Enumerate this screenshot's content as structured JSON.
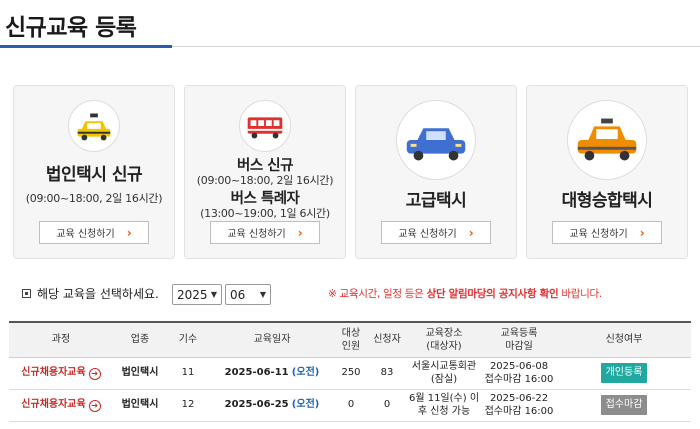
{
  "page": {
    "title": "신규교육 등록"
  },
  "cards": [
    {
      "name": "법인택시 신규",
      "time": "(09:00~18:00, 2일 16시간)",
      "button": "교육 신청하기",
      "icon": "taxi-icon",
      "icon_color": "#f5c400"
    },
    {
      "name": "버스 신규",
      "time": "(09:00~18:00, 2일 16시간)",
      "name2": "버스 특례자",
      "time2": "(13:00~19:00, 1일 6시간)",
      "button": "교육 신청하기",
      "icon": "bus-icon",
      "icon_color": "#e03131"
    },
    {
      "name": "고급택시",
      "button": "교육 신청하기",
      "icon": "premium-taxi-icon",
      "icon_color": "#3f6fd1"
    },
    {
      "name": "대형승합택시",
      "button": "교육 신청하기",
      "icon": "van-taxi-icon",
      "icon_color": "#f08c00"
    }
  ],
  "filter": {
    "label": "해당 교육을 선택하세요.",
    "year": "2025",
    "month": "06",
    "notice_prefix": "※ 교육시간, 일정 등은 ",
    "notice_strong": "상단 알림마당의 공지사항 확인",
    "notice_suffix": " 바랍니다."
  },
  "table": {
    "headers": {
      "course": "과정",
      "biz": "업종",
      "session": "기수",
      "date": "교육일자",
      "target_1": "대상",
      "target_2": "인원",
      "applicants": "신청자",
      "place_1": "교육장소",
      "place_2": "(대상자)",
      "deadline_1": "교육등록",
      "deadline_2": "마감일",
      "status": "신청여부"
    },
    "rows": [
      {
        "course": "신규채용자교육",
        "biz": "법인택시",
        "session": "11",
        "date": "2025-06-11",
        "day": "(오전)",
        "target": "250",
        "applicants": "83",
        "place_1": "서울시교통회관",
        "place_2": "(잠실)",
        "deadline_1": "2025-06-08",
        "deadline_2": "접수마감 16:00",
        "status": "개인등록"
      },
      {
        "course": "신규채용자교육",
        "biz": "법인택시",
        "session": "12",
        "date": "2025-06-25",
        "day": "(오전)",
        "target": "0",
        "applicants": "0",
        "place_1": "6월 11일(수) 이",
        "place_2": "후 신청 가능",
        "deadline_1": "2025-06-22",
        "deadline_2": "접수마감 16:00",
        "status": "접수마감"
      }
    ]
  }
}
